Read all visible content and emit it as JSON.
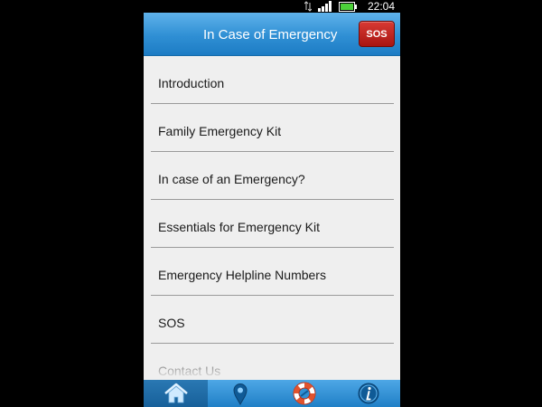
{
  "status_bar": {
    "time": "22:04"
  },
  "header": {
    "title": "In Case of Emergency",
    "sos_label": "SOS"
  },
  "menu": {
    "items": [
      {
        "label": "Introduction"
      },
      {
        "label": "Family Emergency Kit"
      },
      {
        "label": "In case of an Emergency?"
      },
      {
        "label": "Essentials for Emergency Kit"
      },
      {
        "label": "Emergency Helpline Numbers"
      },
      {
        "label": "SOS"
      },
      {
        "label": "Contact Us"
      }
    ]
  },
  "bottom_nav": {
    "tabs": [
      {
        "icon": "home-icon",
        "active": true
      },
      {
        "icon": "location-pin-icon",
        "active": false
      },
      {
        "icon": "lifebuoy-icon",
        "active": false
      },
      {
        "icon": "info-icon",
        "active": false
      }
    ]
  },
  "colors": {
    "header_blue": "#2f8fd4",
    "sos_red": "#c0211d",
    "list_background": "#efefef"
  }
}
